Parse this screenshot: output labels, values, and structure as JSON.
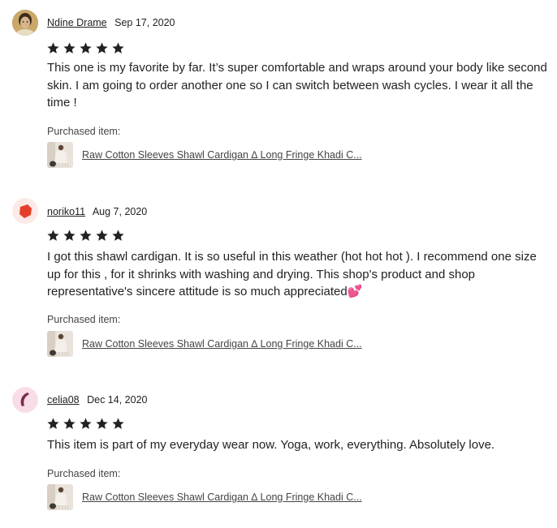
{
  "reviews": [
    {
      "avatar_icon": "user-photo-avatar-icon",
      "username": "Ndine Drame",
      "date": "Sep 17, 2020",
      "rating": 5,
      "text": "This one is my favorite by far. It’s super comfortable and wraps around your body like second skin. I am going to order another one so I can switch between wash cycles. I wear it all the time !",
      "purchased_label": "Purchased item:",
      "item_title": "Raw Cotton Sleeves Shawl Cardigan ∆ Long Fringe Khadi C..."
    },
    {
      "avatar_icon": "red-hexagon-avatar-icon",
      "username": "noriko11",
      "date": "Aug 7, 2020",
      "rating": 5,
      "text": "I got this shawl cardigan. It is so useful in this weather (hot hot hot ). I recommend one size up for this , for it shrinks with washing and drying. This shop's product and shop representative's sincere attitude is so much appreciated💕",
      "purchased_label": "Purchased item:",
      "item_title": "Raw Cotton Sleeves Shawl Cardigan ∆ Long Fringe Khadi C..."
    },
    {
      "avatar_icon": "pink-crescent-avatar-icon",
      "username": "celia08",
      "date": "Dec 14, 2020",
      "rating": 5,
      "text": "This item is part of my everyday wear now. Yoga, work, everything. Absolutely love.",
      "purchased_label": "Purchased item:",
      "item_title": "Raw Cotton Sleeves Shawl Cardigan ∆ Long Fringe Khadi C..."
    }
  ],
  "colors": {
    "star": "#222222",
    "text": "#222222",
    "avatar2_bg": "#fde9e6",
    "avatar2_shape": "#e3402b",
    "avatar3_bg": "#f8dde8",
    "avatar3_shape": "#7a2a4e"
  }
}
